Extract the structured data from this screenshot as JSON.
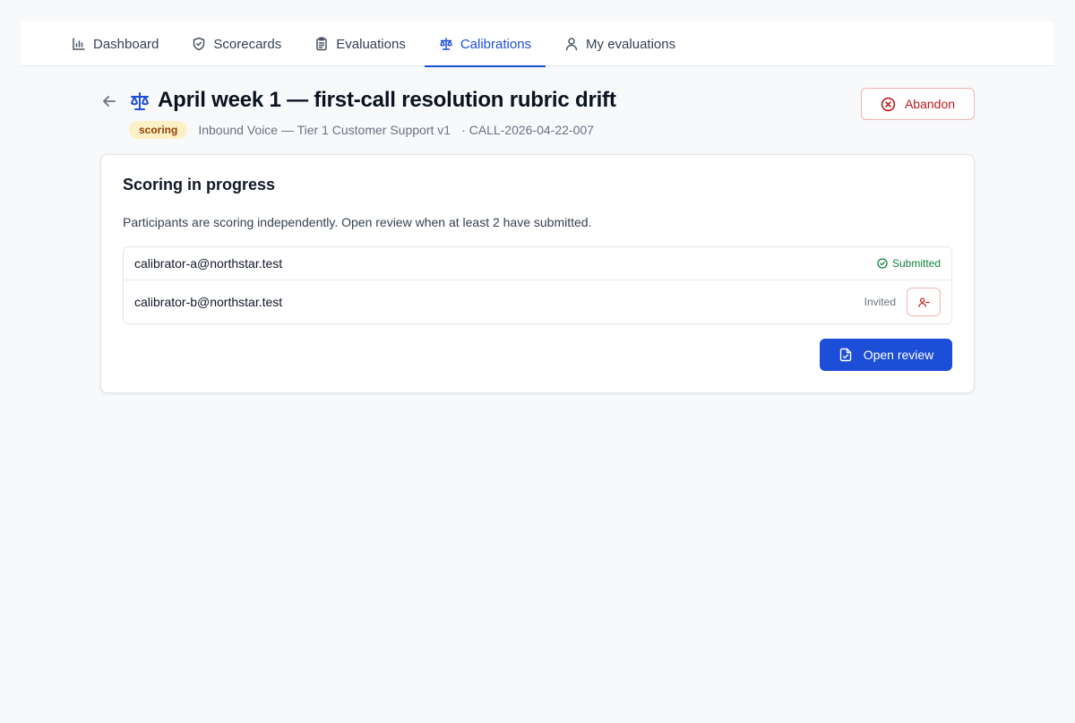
{
  "nav": {
    "tabs": [
      {
        "label": "Dashboard",
        "icon": "bar-chart-icon"
      },
      {
        "label": "Scorecards",
        "icon": "shield-check-icon"
      },
      {
        "label": "Evaluations",
        "icon": "clipboard-list-icon"
      },
      {
        "label": "Calibrations",
        "icon": "scale-icon",
        "active": true
      },
      {
        "label": "My evaluations",
        "icon": "user-icon"
      }
    ]
  },
  "header": {
    "title": "April week 1 — first-call resolution rubric drift",
    "status_badge": "scoring",
    "scorecard": "Inbound Voice — Tier 1 Customer Support v1",
    "call_id": "· CALL-2026-04-22-007",
    "abandon_label": "Abandon"
  },
  "card": {
    "title": "Scoring in progress",
    "description": "Participants are scoring independently. Open review when at least 2 have submitted.",
    "participants": [
      {
        "email": "calibrator-a@northstar.test",
        "status": "Submitted"
      },
      {
        "email": "calibrator-b@northstar.test",
        "status": "Invited"
      }
    ],
    "open_review_label": "Open review"
  },
  "colors": {
    "accent": "#1d4ed8",
    "danger": "#b91c1c",
    "success": "#15803d",
    "badge_bg": "#fdf0c4",
    "badge_text": "#92400e"
  }
}
